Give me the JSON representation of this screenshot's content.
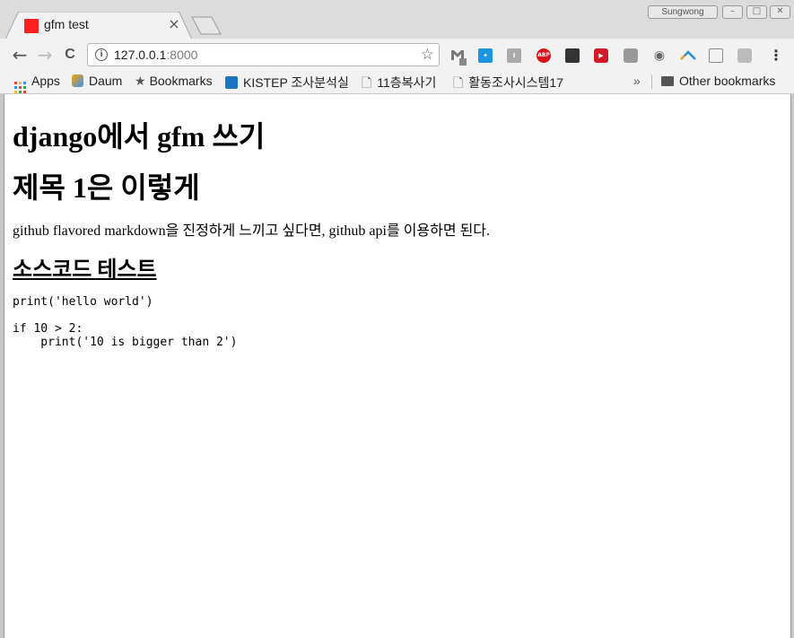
{
  "window": {
    "profile_label": "Sungwong",
    "controls": {
      "minimize": "–",
      "maximize": "□",
      "close": "✕"
    }
  },
  "tab": {
    "title": "gfm test",
    "close": "×",
    "favicon_color": "#ff1f1f"
  },
  "toolbar": {
    "back": "←",
    "forward": "→",
    "reload": "C",
    "url_host": "127.0.0.1",
    "url_port": ":8000",
    "star": "☆",
    "menu": "⋮",
    "extensions": [
      "gmail-icon",
      "bird-icon",
      "grey-ext-icon",
      "adblock-icon",
      "film-icon",
      "video-icon",
      "cloud-icon",
      "camera-icon",
      "arc-icon",
      "panel-icon",
      "square-icon"
    ]
  },
  "bookmarks": {
    "apps": "Apps",
    "daum": "Daum",
    "bookmarks": "Bookmarks",
    "kistep": "KISTEP 조사분석실",
    "copy": "11층복사기",
    "survey": "활동조사시스템17",
    "more": "»",
    "other": "Other bookmarks"
  },
  "page": {
    "title": "django에서 gfm 쓰기",
    "heading1": "제목 1은 이렇게",
    "paragraph": "github flavored markdown을 진정하게 느끼고 싶다면, github api를 이용하면 된다.",
    "heading2": "소스코드 테스트",
    "code": "print('hello world')\n\nif 10 > 2:\n    print('10 is bigger than 2')"
  }
}
